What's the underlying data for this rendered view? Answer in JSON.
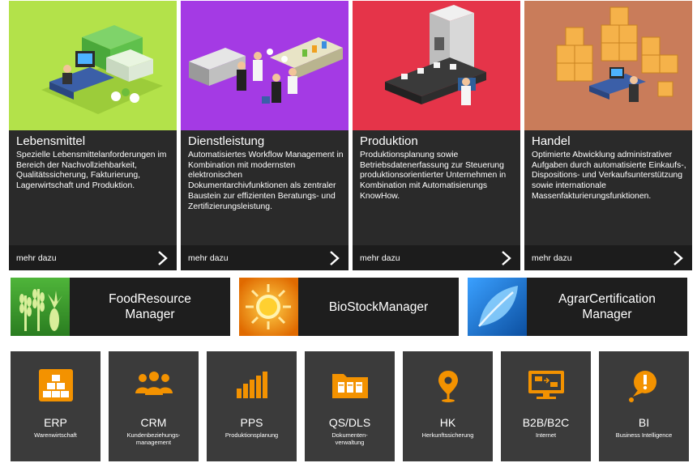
{
  "cards": [
    {
      "title": "Lebensmittel",
      "description": "Spezielle Lebensmittelanforderungen im Bereich der Nachvollziehbarkeit, Qualitätssicherung, Fakturierung, Lagerwirtschaft und Produktion.",
      "more": "mehr dazu",
      "hero_icon": "food-industry-illustration",
      "color": "#b3e24a"
    },
    {
      "title": "Dienstleistung",
      "description": "Automatisiertes Workflow Management in Kombination mit modernsten elektronischen Dokumentarchivfunktionen als zentraler Baustein zur effizienten Beratungs- und Zertifizierungsleistung.",
      "more": "mehr dazu",
      "hero_icon": "services-illustration",
      "color": "#a43ae4"
    },
    {
      "title": "Produktion",
      "description": "Produktionsplanung sowie Betriebsdatenerfassung zur Steuerung produktionsorientierter Unternehmen in Kombination mit Automatisierungs KnowHow.",
      "more": "mehr dazu",
      "hero_icon": "production-illustration",
      "color": "#e53449"
    },
    {
      "title": "Handel",
      "description": "Optimierte Abwicklung administrativer Aufgaben durch automatisierte Einkaufs-, Dispositions- und Verkaufsunterstützung sowie internationale Massenfakturierungsfunktionen.",
      "more": "mehr dazu",
      "hero_icon": "trade-illustration",
      "color": "#c97c5a"
    }
  ],
  "products": [
    {
      "name": "FoodResource\nManager",
      "icon": "crops-icon",
      "color": "#3a9a2a"
    },
    {
      "name": "BioStockManager",
      "icon": "sun-icon",
      "color": "#f08a12"
    },
    {
      "name": "AgrarCertification\nManager",
      "icon": "leaf-icon",
      "color": "#1f74c8"
    }
  ],
  "modules": [
    {
      "abbr": "ERP",
      "sub": "Warenwirtschaft",
      "icon": "boxes-icon"
    },
    {
      "abbr": "CRM",
      "sub": "Kundenbeziehungs-\nmanagement",
      "icon": "people-icon"
    },
    {
      "abbr": "PPS",
      "sub": "Produktionsplanung",
      "icon": "bar-chart-icon"
    },
    {
      "abbr": "QS/DLS",
      "sub": "Dokumenten-\nverwaltung",
      "icon": "document-folder-icon"
    },
    {
      "abbr": "HK",
      "sub": "Herkunftssicherung",
      "icon": "map-pin-icon"
    },
    {
      "abbr": "B2B/B2C",
      "sub": "Internet",
      "icon": "monitor-icon"
    },
    {
      "abbr": "BI",
      "sub": "Business Intelligence",
      "icon": "alert-speech-icon"
    }
  ],
  "accent_color": "#f39200"
}
